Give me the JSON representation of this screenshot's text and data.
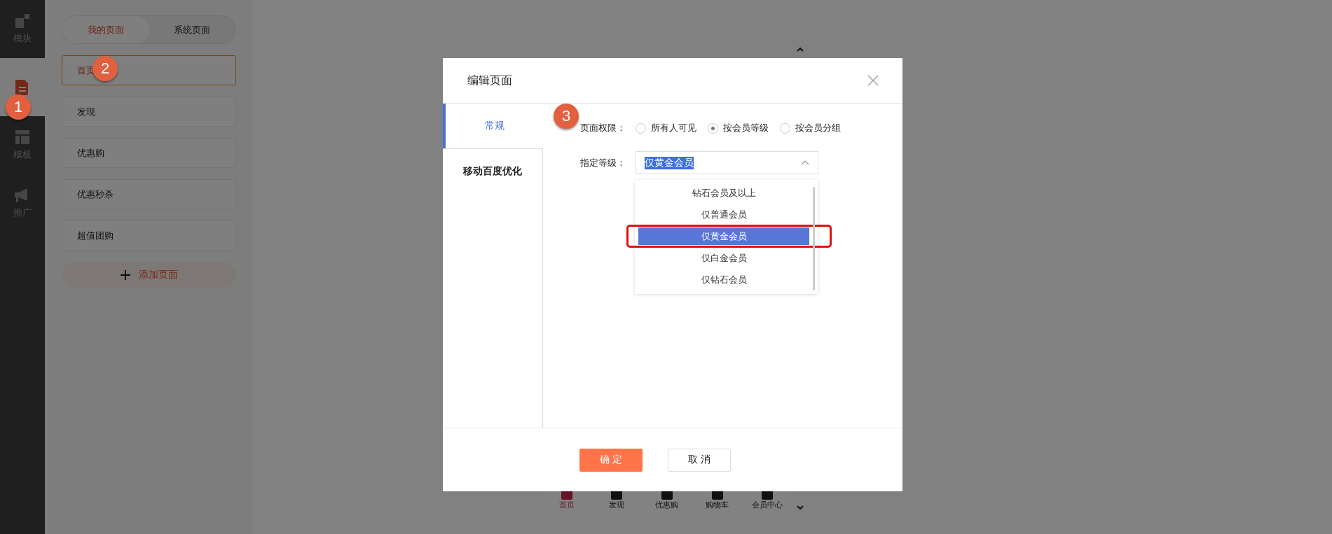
{
  "sidebar": {
    "items": [
      {
        "label": "模块",
        "selected": false
      },
      {
        "selected": true
      },
      {
        "label": "模板",
        "selected": false
      },
      {
        "label": "推广",
        "selected": false
      }
    ]
  },
  "page_tabs": [
    {
      "label": "我的页面",
      "selected": true
    },
    {
      "label": "系统页面",
      "selected": false
    }
  ],
  "pages": [
    {
      "label": "首页",
      "selected": true
    },
    {
      "label": "发现",
      "selected": false
    },
    {
      "label": "优惠购",
      "selected": false
    },
    {
      "label": "优惠秒杀",
      "selected": false
    },
    {
      "label": "超值团购",
      "selected": false
    }
  ],
  "add_page_button": "添加页面",
  "phone_preview": {
    "tabs": [
      {
        "label": "首页",
        "selected": true
      },
      {
        "label": "发现",
        "selected": false
      },
      {
        "label": "优惠购",
        "selected": false
      },
      {
        "label": "购物车",
        "selected": false
      },
      {
        "label": "会员中心",
        "selected": false
      }
    ]
  },
  "dialog": {
    "title": "编辑页面",
    "tabs": [
      {
        "label": "常规",
        "selected": true
      },
      {
        "label": "移动百度优化",
        "selected": false
      }
    ],
    "permission": {
      "label": "页面权限：",
      "options": [
        {
          "label": "所有人可见",
          "selected": false
        },
        {
          "label": "按会员等级",
          "selected": true
        },
        {
          "label": "按会员分组",
          "selected": false
        }
      ]
    },
    "level": {
      "label": "指定等级：",
      "value": "仅黄金会员",
      "expanded": true,
      "options": [
        {
          "label": "钻石会员及以上",
          "selected": false
        },
        {
          "label": "仅普通会员",
          "selected": false
        },
        {
          "label": "仅黄金会员",
          "selected": true
        },
        {
          "label": "仅白金会员",
          "selected": false
        },
        {
          "label": "仅钻石会员",
          "selected": false
        }
      ]
    },
    "confirm_button": "确 定",
    "cancel_button": "取 消"
  },
  "annotations": [
    {
      "number": "1"
    },
    {
      "number": "2"
    },
    {
      "number": "3"
    }
  ]
}
